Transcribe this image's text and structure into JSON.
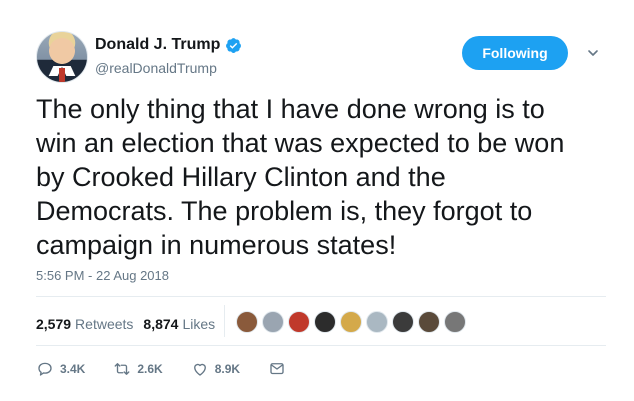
{
  "author": {
    "display_name": "Donald J. Trump",
    "handle": "@realDonaldTrump",
    "verified": true
  },
  "follow_button": {
    "label": "Following"
  },
  "tweet": {
    "text": "The only thing that I have done wrong is to\nwin an election that was expected to be won\nby Crooked Hillary Clinton and the\nDemocrats. The problem is, they forgot to\ncampaign in numerous states!",
    "timestamp": "5:56 PM - 22 Aug 2018"
  },
  "stats": {
    "retweets_count": "2,579",
    "retweets_label": "Retweets",
    "likes_count": "8,874",
    "likes_label": "Likes"
  },
  "liker_avatars": [
    "#8a5a3b",
    "#9aa5b1",
    "#c0392b",
    "#2c2c2c",
    "#d4a94a",
    "#aab8c2",
    "#3b3b3b",
    "#5a4a3a",
    "#777777"
  ],
  "actions": {
    "replies": "3.4K",
    "retweets": "2.6K",
    "likes": "8.9K"
  },
  "colors": {
    "accent": "#1da1f2",
    "text_primary": "#14171a",
    "text_secondary": "#657786"
  }
}
